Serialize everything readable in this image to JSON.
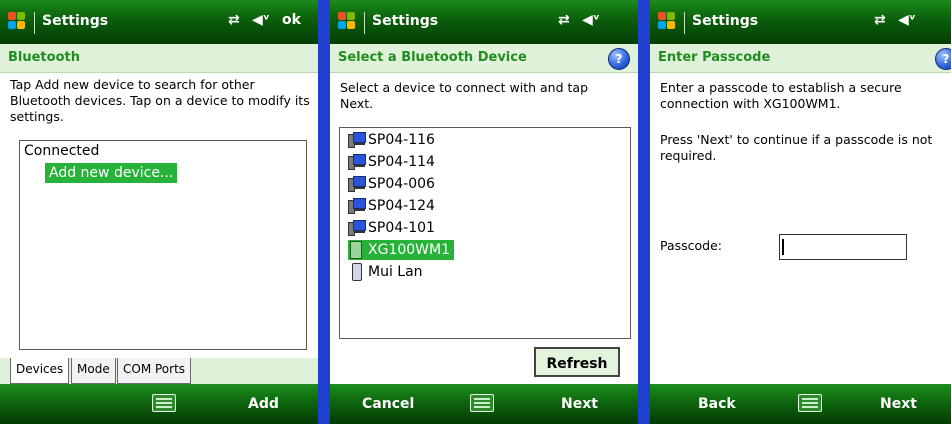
{
  "colors": {
    "accent_green": "#1f8d1f",
    "header_bg": "#dff1d8",
    "divider": "#1f3fcf",
    "selection": "#27b33a"
  },
  "screen1": {
    "title": "Settings",
    "status_icons": [
      "connectivity-icon",
      "volume-icon"
    ],
    "title_ok": "ok",
    "header": "Bluetooth",
    "instruction": "Tap Add new device to search for other Bluetooth devices. Tap on a device to modify its settings.",
    "group_label": "Connected",
    "add_item": "Add new device...",
    "tabs": [
      "Devices",
      "Mode",
      "COM Ports"
    ],
    "softkey_right": "Add"
  },
  "screen2": {
    "title": "Settings",
    "header": "Select a Bluetooth Device",
    "instruction": "Select a device to connect with and tap Next.",
    "devices": [
      {
        "name": "SP04-116",
        "icon": "computer-icon"
      },
      {
        "name": "SP04-114",
        "icon": "computer-icon"
      },
      {
        "name": "SP04-006",
        "icon": "computer-icon"
      },
      {
        "name": "SP04-124",
        "icon": "computer-icon"
      },
      {
        "name": "SP04-101",
        "icon": "computer-icon"
      },
      {
        "name": "XG100WM1",
        "icon": "pda-icon",
        "selected": true
      },
      {
        "name": "Mui Lan",
        "icon": "phone-icon"
      }
    ],
    "refresh": "Refresh",
    "softkey_left": "Cancel",
    "softkey_right": "Next"
  },
  "screen3": {
    "title": "Settings",
    "header": "Enter Passcode",
    "instruction1": "Enter a passcode to establish a secure connection with XG100WM1.",
    "instruction2": "Press 'Next' to continue if a passcode is not required.",
    "passcode_label": "Passcode:",
    "passcode_value": "",
    "softkey_left": "Back",
    "softkey_right": "Next"
  }
}
